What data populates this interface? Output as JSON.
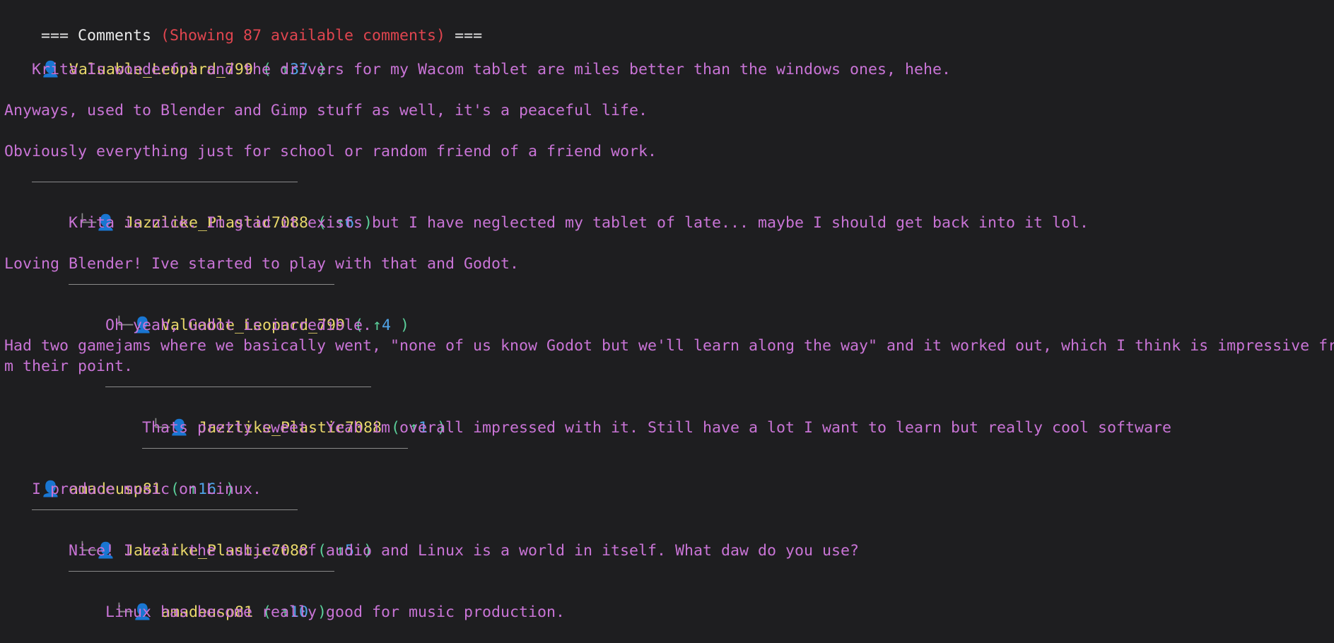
{
  "header": {
    "prefix": "=== Comments ",
    "count_text": "(Showing 87 available comments)",
    "suffix": " ==="
  },
  "icons": {
    "user": "user-icon",
    "upvote": "up-arrow-icon"
  },
  "colors": {
    "background": "#1e1e20",
    "username": "#e8d76a",
    "comment_body": "#c974d6",
    "score": "#4fa3e8",
    "upvote": "#5bcf9a",
    "header_count": "#e0454f"
  },
  "comments": [
    {
      "depth": 0,
      "author": "Valuable_Leopard_799",
      "score": "37",
      "body_lines": [
        "Krita Is wonderful and the drivers for my Wacom tablet are miles better than the windows ones, hehe.",
        "",
        "Anyways, used to Blender and Gimp stuff as well, it's a peaceful life.",
        "",
        "Obviously everything just for school or random friend of a friend work."
      ]
    },
    {
      "depth": 1,
      "author": "Jazzlike_Plastic7088",
      "score": "6",
      "body_lines": [
        "Krita is nice. Im glad it exists but I have neglected my tablet of late... maybe I should get back into it lol.",
        "",
        "Loving Blender! Ive started to play with that and Godot."
      ]
    },
    {
      "depth": 2,
      "author": "Valuable_Leopard_799",
      "score": "4",
      "body_lines": [
        "Oh yeah, Godot is incredible.",
        "Had two gamejams where we basically went, \"none of us know Godot but we'll learn along the way\" and it worked out, which I think is impressive fr",
        "m their point."
      ]
    },
    {
      "depth": 3,
      "author": "Jazzlike_Plastic7088",
      "score": "1",
      "body_lines": [
        "Thats pretty sweet. Yeah im overall impressed with it. Still have a lot I want to learn but really cool software"
      ]
    },
    {
      "depth": 0,
      "author": "amadeusp81",
      "score": "16",
      "body_lines": [
        "I produce music on Linux."
      ]
    },
    {
      "depth": 1,
      "author": "Jazzlike_Plastic7088",
      "score": "5",
      "body_lines": [
        "Nice! I hear the subject of audio and Linux is a world in itself. What daw do you use?"
      ]
    },
    {
      "depth": 2,
      "author": "amadeusp81",
      "score": "10",
      "body_lines": [
        "Linux has become really good for music production."
      ]
    }
  ]
}
